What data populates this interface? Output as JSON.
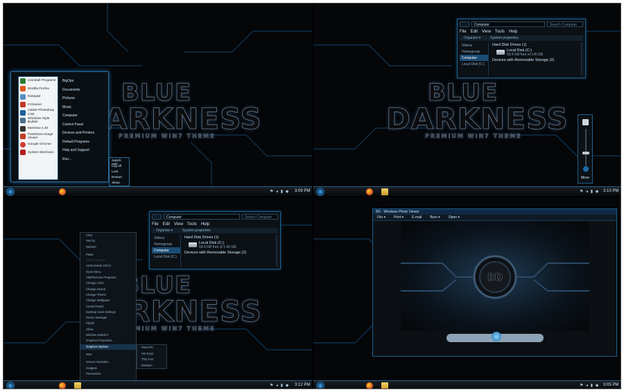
{
  "theme": {
    "logo_line1": "BLUE",
    "logo_line2": "DARKNESS",
    "logo_line3": "PREMIUM WIN7 THEME",
    "accent": "#1e6ca8",
    "background": "#040608"
  },
  "clocks": [
    "3:09 PM",
    "3:10 PM",
    "3:12 PM",
    "3:05 PM"
  ],
  "explorer": {
    "address": "Computer",
    "search_placeholder": "Search Computer",
    "menu": [
      "File",
      "Edit",
      "View",
      "Tools",
      "Help"
    ],
    "commands": [
      "Organize ▾",
      "System properties"
    ],
    "nav": [
      "Videos",
      "Homegroup",
      "Computer",
      "Local Disk (C:)"
    ],
    "group1": "Hard Disk Drives (1)",
    "drive_name": "Local Disk (C:)",
    "drive_free": "59.4 GB free of 140 GB",
    "drive_fill": 0.58,
    "group2": "Devices with Removable Storage (2)"
  },
  "explorer2": {
    "drive_free": "59.4 GB free of 1.60 GB"
  },
  "start_menu": {
    "programs": [
      {
        "label": "Uninstall Programs",
        "color": "#2e7d32"
      },
      {
        "label": "Mozilla Firefox",
        "color": "#e2561a"
      },
      {
        "label": "Notepad",
        "color": "#5a8fc4"
      },
      {
        "label": "CCleaner",
        "color": "#c0392b"
      },
      {
        "label": "Adobe Photoshop CS5",
        "color": "#1f5f9e"
      },
      {
        "label": "Windows Style Builder",
        "color": "#4a6f8e"
      },
      {
        "label": "MarView 4.30",
        "color": "#333333"
      },
      {
        "label": "FastStone Image Viewer",
        "color": "#c23b22"
      },
      {
        "label": "Google Chrome",
        "color": "#d13b2c"
      },
      {
        "label": "System Mechanic",
        "color": "#b02020"
      }
    ],
    "places": [
      "BigOps",
      "Documents",
      "Pictures",
      "Music",
      "Computer",
      "Control Panel",
      "Devices and Printers",
      "Default Programs",
      "Help and Support",
      "Run..."
    ],
    "power_menu": [
      "Switch user",
      "Log off",
      "Lock",
      "Restart",
      "Sleep"
    ]
  },
  "volume": {
    "label": "Mixer",
    "level": 0.35
  },
  "context_menu": {
    "items": [
      "View",
      "Sort by",
      "Refresh",
      "",
      "Paste",
      "Paste shortcut",
      "Undo Delete   Ctrl+Z",
      "Open Menu",
      "Add/Remove Programs",
      "Change Color",
      "Change Sound",
      "Change Theme",
      "Change Wallpaper",
      "Control Panel",
      "Desktop Icons Settings",
      "Device Manager",
      "Flip3D",
      "Show",
      "Window Switcher",
      "Graphics Properties...",
      "Graphics Options",
      "",
      "New",
      "",
      "Screen resolution",
      "Gadgets",
      "Personalize"
    ],
    "highlighted": "Graphics Options",
    "submenu": [
      "Panel Fit",
      "Hot Keys",
      "Tray Icon",
      "Rotation"
    ]
  },
  "photo_viewer": {
    "title": "BD - Windows Photo Viewer",
    "menu": [
      "File ▾",
      "Print ▾",
      "E-mail",
      "Burn ▾",
      "Open ▾"
    ],
    "image_text": "BD"
  }
}
